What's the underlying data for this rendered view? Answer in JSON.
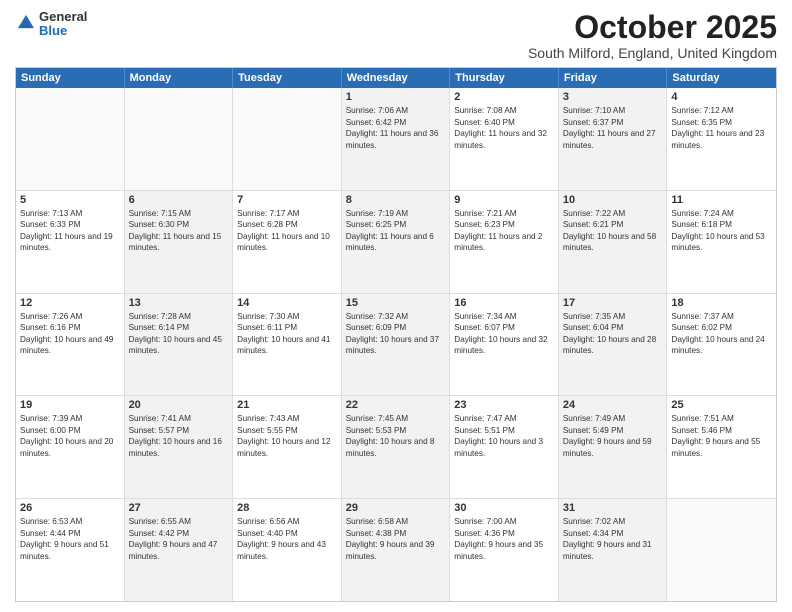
{
  "logo": {
    "general": "General",
    "blue": "Blue"
  },
  "header": {
    "month": "October 2025",
    "location": "South Milford, England, United Kingdom"
  },
  "weekdays": [
    "Sunday",
    "Monday",
    "Tuesday",
    "Wednesday",
    "Thursday",
    "Friday",
    "Saturday"
  ],
  "weeks": [
    [
      {
        "day": "",
        "sunrise": "",
        "sunset": "",
        "daylight": "",
        "shaded": false,
        "empty": true
      },
      {
        "day": "",
        "sunrise": "",
        "sunset": "",
        "daylight": "",
        "shaded": true,
        "empty": true
      },
      {
        "day": "",
        "sunrise": "",
        "sunset": "",
        "daylight": "",
        "shaded": false,
        "empty": true
      },
      {
        "day": "1",
        "sunrise": "Sunrise: 7:06 AM",
        "sunset": "Sunset: 6:42 PM",
        "daylight": "Daylight: 11 hours and 36 minutes.",
        "shaded": true
      },
      {
        "day": "2",
        "sunrise": "Sunrise: 7:08 AM",
        "sunset": "Sunset: 6:40 PM",
        "daylight": "Daylight: 11 hours and 32 minutes.",
        "shaded": false
      },
      {
        "day": "3",
        "sunrise": "Sunrise: 7:10 AM",
        "sunset": "Sunset: 6:37 PM",
        "daylight": "Daylight: 11 hours and 27 minutes.",
        "shaded": true
      },
      {
        "day": "4",
        "sunrise": "Sunrise: 7:12 AM",
        "sunset": "Sunset: 6:35 PM",
        "daylight": "Daylight: 11 hours and 23 minutes.",
        "shaded": false
      }
    ],
    [
      {
        "day": "5",
        "sunrise": "Sunrise: 7:13 AM",
        "sunset": "Sunset: 6:33 PM",
        "daylight": "Daylight: 11 hours and 19 minutes.",
        "shaded": false
      },
      {
        "day": "6",
        "sunrise": "Sunrise: 7:15 AM",
        "sunset": "Sunset: 6:30 PM",
        "daylight": "Daylight: 11 hours and 15 minutes.",
        "shaded": true
      },
      {
        "day": "7",
        "sunrise": "Sunrise: 7:17 AM",
        "sunset": "Sunset: 6:28 PM",
        "daylight": "Daylight: 11 hours and 10 minutes.",
        "shaded": false
      },
      {
        "day": "8",
        "sunrise": "Sunrise: 7:19 AM",
        "sunset": "Sunset: 6:25 PM",
        "daylight": "Daylight: 11 hours and 6 minutes.",
        "shaded": true
      },
      {
        "day": "9",
        "sunrise": "Sunrise: 7:21 AM",
        "sunset": "Sunset: 6:23 PM",
        "daylight": "Daylight: 11 hours and 2 minutes.",
        "shaded": false
      },
      {
        "day": "10",
        "sunrise": "Sunrise: 7:22 AM",
        "sunset": "Sunset: 6:21 PM",
        "daylight": "Daylight: 10 hours and 58 minutes.",
        "shaded": true
      },
      {
        "day": "11",
        "sunrise": "Sunrise: 7:24 AM",
        "sunset": "Sunset: 6:18 PM",
        "daylight": "Daylight: 10 hours and 53 minutes.",
        "shaded": false
      }
    ],
    [
      {
        "day": "12",
        "sunrise": "Sunrise: 7:26 AM",
        "sunset": "Sunset: 6:16 PM",
        "daylight": "Daylight: 10 hours and 49 minutes.",
        "shaded": false
      },
      {
        "day": "13",
        "sunrise": "Sunrise: 7:28 AM",
        "sunset": "Sunset: 6:14 PM",
        "daylight": "Daylight: 10 hours and 45 minutes.",
        "shaded": true
      },
      {
        "day": "14",
        "sunrise": "Sunrise: 7:30 AM",
        "sunset": "Sunset: 6:11 PM",
        "daylight": "Daylight: 10 hours and 41 minutes.",
        "shaded": false
      },
      {
        "day": "15",
        "sunrise": "Sunrise: 7:32 AM",
        "sunset": "Sunset: 6:09 PM",
        "daylight": "Daylight: 10 hours and 37 minutes.",
        "shaded": true
      },
      {
        "day": "16",
        "sunrise": "Sunrise: 7:34 AM",
        "sunset": "Sunset: 6:07 PM",
        "daylight": "Daylight: 10 hours and 32 minutes.",
        "shaded": false
      },
      {
        "day": "17",
        "sunrise": "Sunrise: 7:35 AM",
        "sunset": "Sunset: 6:04 PM",
        "daylight": "Daylight: 10 hours and 28 minutes.",
        "shaded": true
      },
      {
        "day": "18",
        "sunrise": "Sunrise: 7:37 AM",
        "sunset": "Sunset: 6:02 PM",
        "daylight": "Daylight: 10 hours and 24 minutes.",
        "shaded": false
      }
    ],
    [
      {
        "day": "19",
        "sunrise": "Sunrise: 7:39 AM",
        "sunset": "Sunset: 6:00 PM",
        "daylight": "Daylight: 10 hours and 20 minutes.",
        "shaded": false
      },
      {
        "day": "20",
        "sunrise": "Sunrise: 7:41 AM",
        "sunset": "Sunset: 5:57 PM",
        "daylight": "Daylight: 10 hours and 16 minutes.",
        "shaded": true
      },
      {
        "day": "21",
        "sunrise": "Sunrise: 7:43 AM",
        "sunset": "Sunset: 5:55 PM",
        "daylight": "Daylight: 10 hours and 12 minutes.",
        "shaded": false
      },
      {
        "day": "22",
        "sunrise": "Sunrise: 7:45 AM",
        "sunset": "Sunset: 5:53 PM",
        "daylight": "Daylight: 10 hours and 8 minutes.",
        "shaded": true
      },
      {
        "day": "23",
        "sunrise": "Sunrise: 7:47 AM",
        "sunset": "Sunset: 5:51 PM",
        "daylight": "Daylight: 10 hours and 3 minutes.",
        "shaded": false
      },
      {
        "day": "24",
        "sunrise": "Sunrise: 7:49 AM",
        "sunset": "Sunset: 5:49 PM",
        "daylight": "Daylight: 9 hours and 59 minutes.",
        "shaded": true
      },
      {
        "day": "25",
        "sunrise": "Sunrise: 7:51 AM",
        "sunset": "Sunset: 5:46 PM",
        "daylight": "Daylight: 9 hours and 55 minutes.",
        "shaded": false
      }
    ],
    [
      {
        "day": "26",
        "sunrise": "Sunrise: 6:53 AM",
        "sunset": "Sunset: 4:44 PM",
        "daylight": "Daylight: 9 hours and 51 minutes.",
        "shaded": false
      },
      {
        "day": "27",
        "sunrise": "Sunrise: 6:55 AM",
        "sunset": "Sunset: 4:42 PM",
        "daylight": "Daylight: 9 hours and 47 minutes.",
        "shaded": true
      },
      {
        "day": "28",
        "sunrise": "Sunrise: 6:56 AM",
        "sunset": "Sunset: 4:40 PM",
        "daylight": "Daylight: 9 hours and 43 minutes.",
        "shaded": false
      },
      {
        "day": "29",
        "sunrise": "Sunrise: 6:58 AM",
        "sunset": "Sunset: 4:38 PM",
        "daylight": "Daylight: 9 hours and 39 minutes.",
        "shaded": true
      },
      {
        "day": "30",
        "sunrise": "Sunrise: 7:00 AM",
        "sunset": "Sunset: 4:36 PM",
        "daylight": "Daylight: 9 hours and 35 minutes.",
        "shaded": false
      },
      {
        "day": "31",
        "sunrise": "Sunrise: 7:02 AM",
        "sunset": "Sunset: 4:34 PM",
        "daylight": "Daylight: 9 hours and 31 minutes.",
        "shaded": true
      },
      {
        "day": "",
        "sunrise": "",
        "sunset": "",
        "daylight": "",
        "shaded": false,
        "empty": true
      }
    ]
  ]
}
